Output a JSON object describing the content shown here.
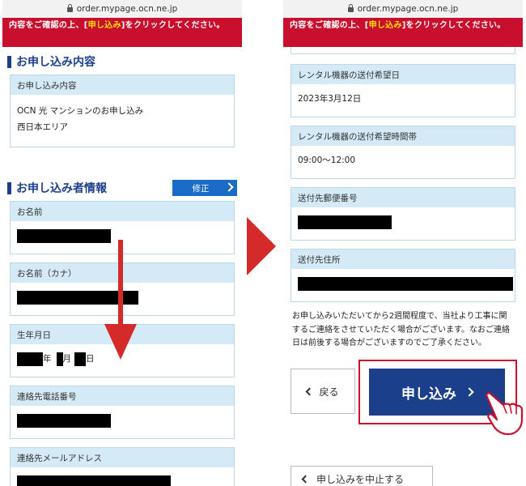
{
  "left": {
    "url": "order.mypage.ocn.ne.jp",
    "banner": {
      "text_before": "内容をご確認の上、[",
      "highlight": "申し込み",
      "text_after": "]をクリックしてください。"
    },
    "section1_title": "お申し込み内容",
    "order_card": {
      "label": "お申し込み内容",
      "line1": "OCN 光 マンションのお申し込み",
      "line2": "西日本エリア"
    },
    "section2_title": "お申し込み者情報",
    "edit_label": "修正",
    "name_label": "お名前",
    "kana_label": "お名前（カナ）",
    "dob": {
      "label": "生年月日",
      "year_suffix": "年",
      "month_suffix": "月",
      "day_suffix": "日"
    },
    "phone_label": "連絡先電話番号",
    "email_label": "連絡先メールアドレス"
  },
  "right": {
    "url": "order.mypage.ocn.ne.jp",
    "banner": {
      "text_before": "内容をご確認の上、[",
      "highlight": "申し込み",
      "text_after": "]をクリックしてください。"
    },
    "delivery_date": {
      "label": "レンタル機器の送付希望日",
      "value": "2023年3月12日"
    },
    "delivery_time": {
      "label": "レンタル機器の送付希望時間帯",
      "value": "09:00〜12:00"
    },
    "postal_label": "送付先郵便番号",
    "address_label": "送付先住所",
    "note": "お申し込みいただいてから2週間程度で、当社より工事に関するご連絡をさせていただく場合がございます。なおご連絡日は前後する場合がございますのでご了承ください。",
    "back_label": "戻る",
    "submit_label": "申し込み",
    "cancel_label": "申し込みを中止する"
  },
  "colors": {
    "banner_red": "#c8102e",
    "highlight_yellow": "#ffe600",
    "navy": "#1b3f8b",
    "card_label_bg": "#d4eaf7",
    "arrow_red": "#d42a2a"
  }
}
